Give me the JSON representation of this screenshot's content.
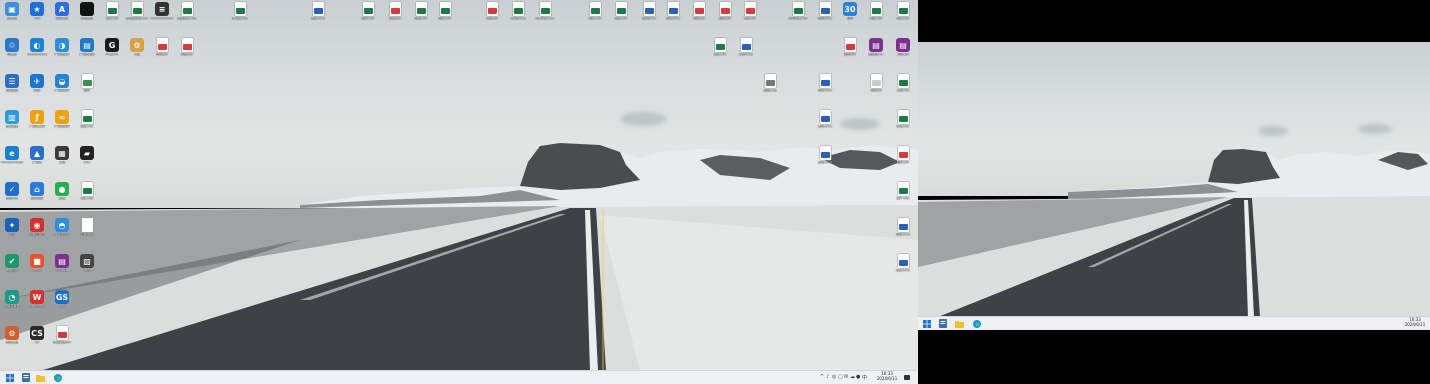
{
  "monitor1": {
    "clock": {
      "time": "10:33",
      "date": "2024/6/11"
    },
    "taskbar": {
      "apps": [
        {
          "name": "start-icon"
        },
        {
          "name": "file-manager-icon"
        },
        {
          "name": "folder-icon"
        },
        {
          "name": "edge-browser-icon"
        }
      ],
      "tray": [
        "^",
        "♪",
        "◎",
        "▢",
        "✉",
        "☁",
        "●",
        "中"
      ]
    },
    "icons": [
      {
        "label": "此电脑",
        "color": "#3b8fd9",
        "kind": "app",
        "glyph": "▣"
      },
      {
        "label": "Trae",
        "color": "#1e6fd8",
        "kind": "app",
        "glyph": "★"
      },
      {
        "label": "链接工具",
        "color": "#2b6de0",
        "kind": "app",
        "glyph": "A"
      },
      {
        "label": "账号信息",
        "color": "#111111",
        "kind": "app",
        "glyph": ""
      },
      {
        "label": "工作.xlsx",
        "color": "#1d7a45",
        "kind": "doc",
        "glyph": ""
      },
      {
        "label": "数据统计表.xlsx",
        "color": "#1d7a45",
        "kind": "doc",
        "glyph": ""
      },
      {
        "label": "Characteristics",
        "color": "#333333",
        "kind": "app",
        "glyph": "≡"
      },
      {
        "label": "数据汇总.xlsx",
        "color": "#1d7a45",
        "kind": "doc",
        "glyph": ""
      },
      {
        "label": "回收站",
        "color": "#2a79c9",
        "kind": "app",
        "glyph": "♲"
      },
      {
        "label": "EasyConnect",
        "color": "#1c82d6",
        "kind": "app",
        "glyph": "◐"
      },
      {
        "label": "广联达软件",
        "color": "#2a8fd8",
        "kind": "app",
        "glyph": "◑"
      },
      {
        "label": "广联达管理",
        "color": "#1f7ac8",
        "kind": "app",
        "glyph": "▤"
      },
      {
        "label": "Kingdee",
        "color": "#1b1b1b",
        "kind": "app",
        "glyph": "G"
      },
      {
        "label": "工具",
        "color": "#d9a04a",
        "kind": "app",
        "glyph": "⚙"
      },
      {
        "label": "合同.pdf",
        "color": "#d63b3b",
        "kind": "doc",
        "glyph": ""
      },
      {
        "label": "报告.pdf",
        "color": "#d63b3b",
        "kind": "doc",
        "glyph": ""
      },
      {
        "label": "控制面板",
        "color": "#2a6fc4",
        "kind": "app",
        "glyph": "☰"
      },
      {
        "label": "网络",
        "color": "#1e74d1",
        "kind": "app",
        "glyph": "✈"
      },
      {
        "label": "广联达助手",
        "color": "#2782d6",
        "kind": "app",
        "glyph": "◒"
      },
      {
        "label": "图片",
        "color": "#3f8f4a",
        "kind": "doc",
        "glyph": ""
      },
      {
        "label": "远程桌面",
        "color": "#2c9bd8",
        "kind": "app",
        "glyph": "▥"
      },
      {
        "label": "广联达工程",
        "color": "#f0a013",
        "kind": "app",
        "glyph": "ƒ"
      },
      {
        "label": "广联达预算",
        "color": "#f0a013",
        "kind": "app",
        "glyph": "∞"
      },
      {
        "label": "表格.xlsx",
        "color": "#1d7a45",
        "kind": "doc",
        "glyph": ""
      },
      {
        "label": "Microsoft Edge",
        "color": "#1a7fd0",
        "kind": "app",
        "glyph": "e"
      },
      {
        "label": "广联达",
        "color": "#2b6fc9",
        "kind": "app",
        "glyph": "▲"
      },
      {
        "label": "工程",
        "color": "#3a3a3a",
        "kind": "app",
        "glyph": "▦"
      },
      {
        "label": "CAD",
        "color": "#222222",
        "kind": "app",
        "glyph": "▰"
      },
      {
        "label": "安全中心",
        "color": "#1f6ccf",
        "kind": "app",
        "glyph": "✓"
      },
      {
        "label": "应用商店",
        "color": "#2a7bd6",
        "kind": "app",
        "glyph": "⌂"
      },
      {
        "label": "微信",
        "color": "#22b14c",
        "kind": "app",
        "glyph": "●"
      },
      {
        "label": "清单.xlsx",
        "color": "#1d7a45",
        "kind": "doc",
        "glyph": ""
      },
      {
        "label": "蓝牙",
        "color": "#1c5fb8",
        "kind": "app",
        "glyph": "✦"
      },
      {
        "label": "网易云音乐",
        "color": "#d62f2f",
        "kind": "app",
        "glyph": "◉"
      },
      {
        "label": "广联达服务",
        "color": "#2b90d9",
        "kind": "app",
        "glyph": "◓"
      },
      {
        "label": "记录.xlsx",
        "color": "#ffffff",
        "kind": "doc",
        "glyph": ""
      },
      {
        "label": "电脑管家",
        "color": "#1a9a6a",
        "kind": "app",
        "glyph": "✔"
      },
      {
        "label": "Office",
        "color": "#e8532b",
        "kind": "app",
        "glyph": "■"
      },
      {
        "label": "WinRAR",
        "color": "#7d2e8e",
        "kind": "app",
        "glyph": "▤"
      },
      {
        "label": "游戏",
        "color": "#444444",
        "kind": "app",
        "glyph": "▧"
      },
      {
        "label": "广联达算量",
        "color": "#1f9a8a",
        "kind": "app",
        "glyph": "◔"
      },
      {
        "label": "WPS Office",
        "color": "#d8302b",
        "kind": "app",
        "glyph": "W"
      },
      {
        "label": "GS",
        "color": "#1d6fc4",
        "kind": "app",
        "glyph": "GS"
      },
      {
        "label": "测试工具",
        "color": "#d35d2b",
        "kind": "app",
        "glyph": "⚙"
      },
      {
        "label": "CS",
        "color": "#2a2a2a",
        "kind": "app",
        "glyph": "CS"
      },
      {
        "label": "开发文档.pdf",
        "color": "#d63b3b",
        "kind": "doc",
        "glyph": ""
      },
      {
        "label": "汇总表.xlsx",
        "color": "#1d7a45",
        "kind": "doc",
        "glyph": ""
      },
      {
        "label": "方案.docx",
        "color": "#2b5fbf",
        "kind": "doc",
        "glyph": ""
      },
      {
        "label": "预算.xlsx",
        "color": "#1d7a45",
        "kind": "doc",
        "glyph": ""
      },
      {
        "label": "资料.pdf",
        "color": "#d63b3b",
        "kind": "doc",
        "glyph": ""
      },
      {
        "label": "明细.xlsx",
        "color": "#1d7a45",
        "kind": "doc",
        "glyph": ""
      },
      {
        "label": "结算.xlsx",
        "color": "#1d7a45",
        "kind": "doc",
        "glyph": ""
      },
      {
        "label": "审核.pdf",
        "color": "#d63b3b",
        "kind": "doc",
        "glyph": ""
      },
      {
        "label": "工程量.xlsx",
        "color": "#1d7a45",
        "kind": "doc",
        "glyph": ""
      },
      {
        "label": "清单计价.xlsx",
        "color": "#1d7a45",
        "kind": "doc",
        "glyph": ""
      },
      {
        "label": "材料.xlsx",
        "color": "#1d7a45",
        "kind": "doc",
        "glyph": ""
      },
      {
        "label": "台账.xlsx",
        "color": "#1d7a45",
        "kind": "doc",
        "glyph": ""
      },
      {
        "label": "说明.docx",
        "color": "#2b5fbf",
        "kind": "doc",
        "glyph": ""
      },
      {
        "label": "记录.docx",
        "color": "#2b5fbf",
        "kind": "doc",
        "glyph": ""
      },
      {
        "label": "申请.pdf",
        "color": "#d63b3b",
        "kind": "doc",
        "glyph": ""
      },
      {
        "label": "核对.pdf",
        "color": "#d63b3b",
        "kind": "doc",
        "glyph": ""
      },
      {
        "label": "统计.pdf",
        "color": "#d63b3b",
        "kind": "doc",
        "glyph": ""
      },
      {
        "label": "合同台账.xlsx",
        "color": "#1d7a45",
        "kind": "doc",
        "glyph": ""
      },
      {
        "label": "简历.docx",
        "color": "#2b5fbf",
        "kind": "doc",
        "glyph": ""
      },
      {
        "label": "日历",
        "color": "#2b7fd6",
        "kind": "app",
        "glyph": "30"
      },
      {
        "label": "进度.xlsx",
        "color": "#1d7a45",
        "kind": "doc",
        "glyph": ""
      },
      {
        "label": "分析.xlsx",
        "color": "#1d7a45",
        "kind": "doc",
        "glyph": ""
      },
      {
        "label": "对比.xlsx",
        "color": "#1d7a45",
        "kind": "doc",
        "glyph": ""
      },
      {
        "label": "汇报.docx",
        "color": "#2b5fbf",
        "kind": "doc",
        "glyph": ""
      },
      {
        "label": "图纸.pdf",
        "color": "#d63b3b",
        "kind": "doc",
        "glyph": ""
      },
      {
        "label": "压缩包.rar",
        "color": "#7d2e8e",
        "kind": "app",
        "glyph": "▤"
      },
      {
        "label": "项目.zip",
        "color": "#7d2e8e",
        "kind": "app",
        "glyph": "▤"
      },
      {
        "label": "截图.png",
        "color": "#777777",
        "kind": "doc",
        "glyph": ""
      },
      {
        "label": "报价.docx",
        "color": "#2b5fbf",
        "kind": "doc",
        "glyph": ""
      },
      {
        "label": "草稿.txt",
        "color": "#cccccc",
        "kind": "doc",
        "glyph": ""
      },
      {
        "label": "工期.xlsx",
        "color": "#1d7a45",
        "kind": "doc",
        "glyph": ""
      },
      {
        "label": "交底.docx",
        "color": "#2b5fbf",
        "kind": "doc",
        "glyph": ""
      },
      {
        "label": "计划.xlsx",
        "color": "#1d7a45",
        "kind": "doc",
        "glyph": ""
      },
      {
        "label": "通知.docx",
        "color": "#2b5fbf",
        "kind": "doc",
        "glyph": ""
      },
      {
        "label": "核算.pdf",
        "color": "#d63b3b",
        "kind": "doc",
        "glyph": ""
      },
      {
        "label": "客户.xlsx",
        "color": "#1d7a45",
        "kind": "doc",
        "glyph": ""
      },
      {
        "label": "会议.docx",
        "color": "#2b5fbf",
        "kind": "doc",
        "glyph": ""
      },
      {
        "label": "笔记.docx",
        "color": "#2b5fbf",
        "kind": "doc",
        "glyph": ""
      }
    ]
  },
  "monitor2": {
    "clock": {
      "time": "10:33",
      "date": "2024/6/11"
    },
    "taskbar": {
      "apps": [
        {
          "name": "start-icon"
        },
        {
          "name": "file-manager-icon"
        },
        {
          "name": "folder-icon"
        },
        {
          "name": "edge-browser-icon"
        }
      ]
    }
  }
}
